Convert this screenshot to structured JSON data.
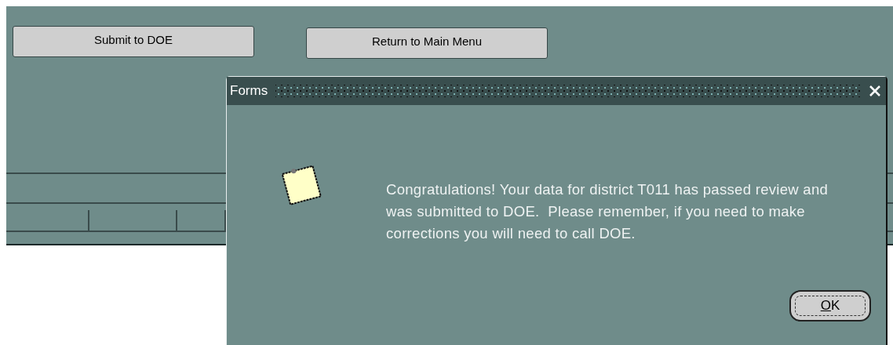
{
  "toolbar": {
    "buttons": [
      "Submit to DOE",
      "Return to Main Menu"
    ]
  },
  "dialog": {
    "title": "Forms",
    "message": "Congratulations! Your data for district T011 has passed review and was submitted to DOE.  Please remember, if you need to make corrections you will need to call DOE.",
    "button": "OK"
  }
}
